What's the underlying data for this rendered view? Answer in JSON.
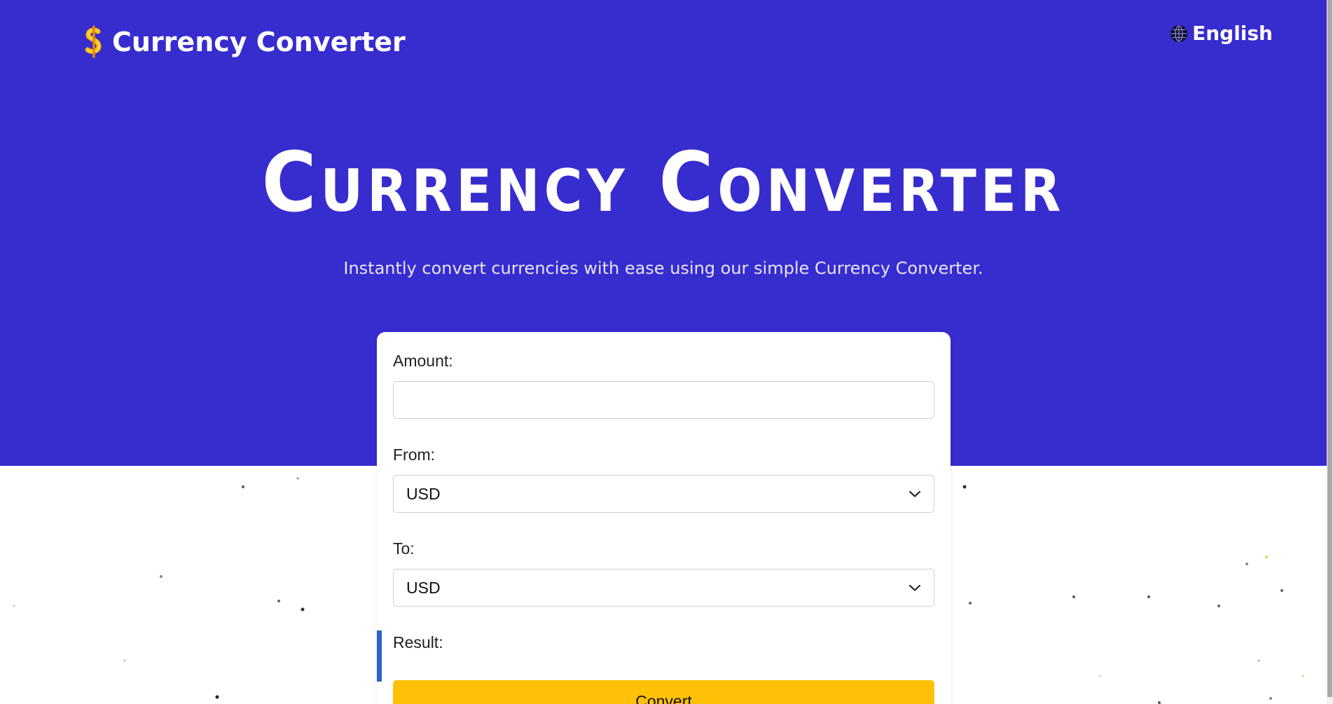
{
  "header": {
    "brand_name": "Currency Converter",
    "brand_icon": "dollar-sign-icon",
    "language_label": "English",
    "language_icon": "globe-icon"
  },
  "hero": {
    "title": "Currency Converter",
    "subtitle": "Instantly convert currencies with ease using our simple Currency Converter."
  },
  "form": {
    "amount_label": "Amount:",
    "amount_value": "",
    "amount_placeholder": "",
    "from_label": "From:",
    "from_value": "USD",
    "to_label": "To:",
    "to_value": "USD",
    "result_label": "Result:",
    "convert_label": "Convert"
  },
  "colors": {
    "hero_background": "#372cce",
    "button_background": "#ffc107",
    "result_accent": "#2c63c7",
    "icon_gold": "#f5b50a"
  }
}
